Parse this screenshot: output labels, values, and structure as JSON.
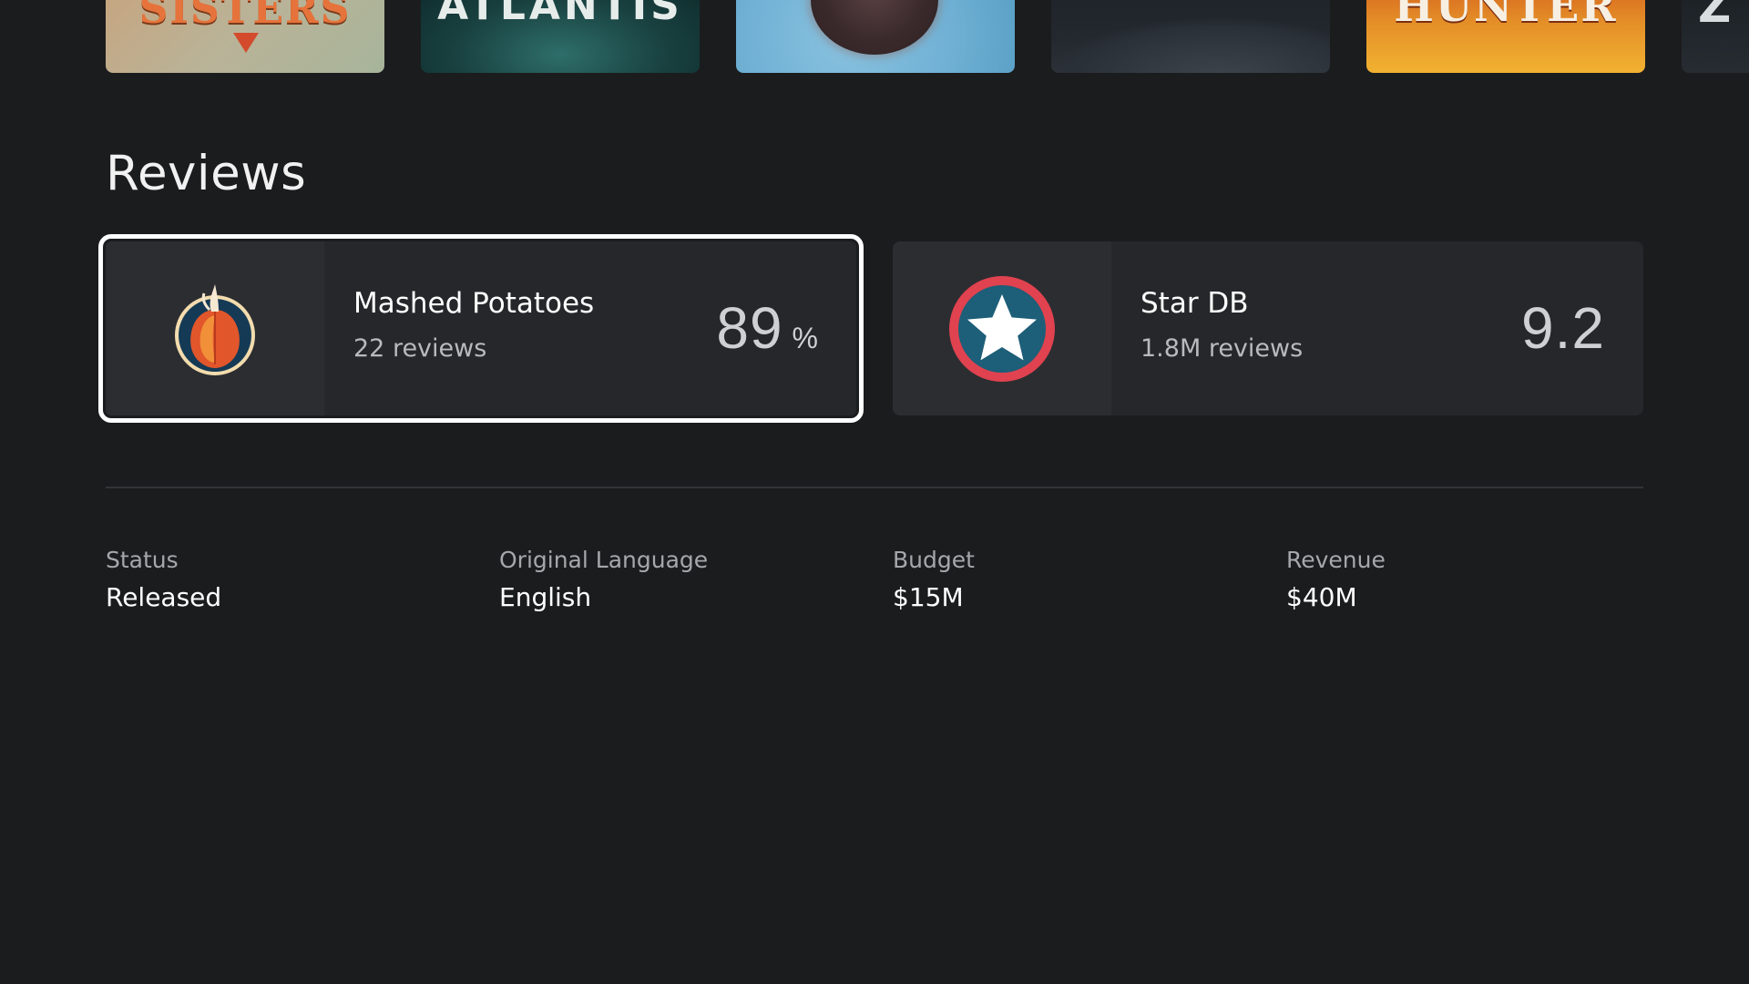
{
  "posters": [
    {
      "title": "SISTERS"
    },
    {
      "title": "ATLANTIS"
    },
    {
      "title": ""
    },
    {
      "title": ""
    },
    {
      "title": "HUNTER"
    },
    {
      "title": "Z"
    }
  ],
  "reviews": {
    "heading": "Reviews",
    "cards": [
      {
        "source": "Mashed Potatoes",
        "count": "22 reviews",
        "score": "89",
        "unit": "%",
        "icon": "mashed-potatoes-logo-icon",
        "focused": true
      },
      {
        "source": "Star DB",
        "count": "1.8M reviews",
        "score": "9.2",
        "unit": "",
        "icon": "star-db-logo-icon",
        "focused": false
      }
    ]
  },
  "facts": [
    {
      "label": "Status",
      "value": "Released"
    },
    {
      "label": "Original Language",
      "value": "English"
    },
    {
      "label": "Budget",
      "value": "$15M"
    },
    {
      "label": "Revenue",
      "value": "$40M"
    }
  ],
  "colors": {
    "background": "#1b1c1e",
    "card": "#26272a",
    "focus_outline": "#ffffff",
    "star_ring": "#e0424f",
    "star_disc": "#1d5e78"
  }
}
